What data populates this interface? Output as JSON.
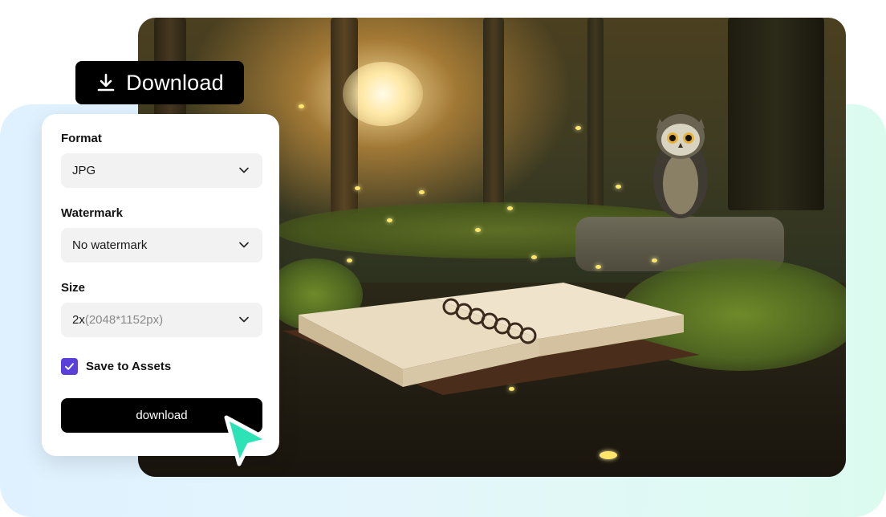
{
  "header": {
    "download_label": "Download",
    "download_icon": "download-icon"
  },
  "panel": {
    "format": {
      "label": "Format",
      "value": "JPG"
    },
    "watermark": {
      "label": "Watermark",
      "value": "No watermark"
    },
    "size": {
      "label": "Size",
      "value": "2x",
      "detail": "(2048*1152px)"
    },
    "save_to_assets": {
      "label": "Save to Assets",
      "checked": true
    },
    "download_button": "download"
  },
  "colors": {
    "accent": "#5b3fd9",
    "button_bg": "#000000",
    "cursor": "#2de2b4",
    "select_bg": "#f2f2f2"
  }
}
